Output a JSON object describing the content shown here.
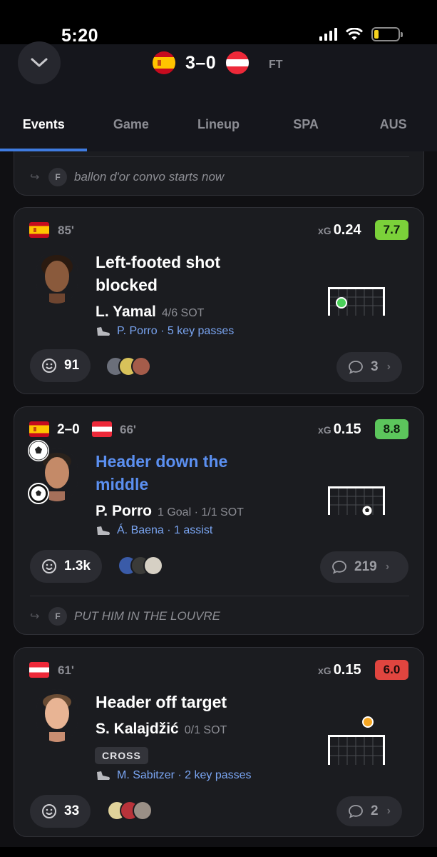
{
  "status": {
    "time": "5:20"
  },
  "header": {
    "score": "3–0",
    "status": "FT",
    "home_team": "SPA",
    "away_team": "AUS"
  },
  "tabs": [
    {
      "label": "Events",
      "active": true
    },
    {
      "label": "Game",
      "active": false
    },
    {
      "label": "Lineup",
      "active": false
    },
    {
      "label": "SPA",
      "active": false
    },
    {
      "label": "AUS",
      "active": false
    }
  ],
  "colors": {
    "accent": "#3f7be0",
    "rating_green": "#7bd13a",
    "rating_green_2": "#5cc65c",
    "rating_red": "#e0453f",
    "link": "#7aa5f2"
  },
  "events": [
    {
      "top_reply": {
        "badge": "F",
        "text": "ballon d'or convo starts now"
      }
    },
    {
      "flag": "spain",
      "minute": "85'",
      "xg_label": "xG",
      "xg": "0.24",
      "rating": "7.7",
      "title": "Left-footed shot blocked",
      "player": "L. Yamal",
      "player_stat": "4/6 SOT",
      "assist": "P. Porro · 5 key passes",
      "reactions": "91",
      "comments": "3"
    },
    {
      "minute": "66'",
      "mini_score": "2–0",
      "xg_label": "xG",
      "xg": "0.15",
      "rating": "8.8",
      "title": "Header down the middle",
      "player": "P. Porro",
      "player_stat": "1 Goal · 1/1 SOT",
      "assist": "Á. Baena · 1 assist",
      "reactions": "1.3k",
      "comments": "219",
      "reply": {
        "badge": "F",
        "text": "PUT HIM IN THE LOUVRE"
      }
    },
    {
      "flag": "austria",
      "minute": "61'",
      "xg_label": "xG",
      "xg": "0.15",
      "rating": "6.0",
      "title": "Header off target",
      "player": "S. Kalajdžić",
      "player_stat": "0/1 SOT",
      "tag": "CROSS",
      "assist": "M. Sabitzer · 2 key passes",
      "reactions": "33",
      "comments": "2"
    }
  ]
}
